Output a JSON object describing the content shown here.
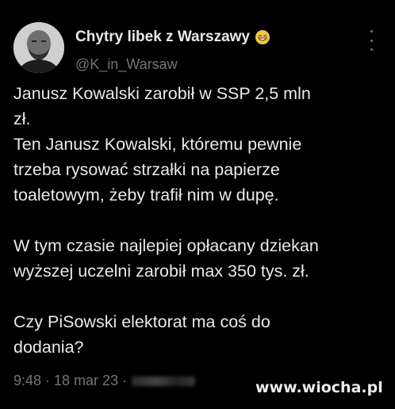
{
  "author": {
    "display_name": "Chytry libek z Warszawy",
    "emoji": "grinning-sweat-emoji",
    "handle": "@K_in_Warsaw"
  },
  "tweet": {
    "paragraphs": [
      {
        "lines": [
          "Janusz Kowalski zarobił w SSP 2,5 mln",
          "zł.",
          "Ten Janusz Kowalski, któremu pewnie",
          "trzeba rysować strzałki na papierze",
          "toaletowym, żeby trafił nim w dupę."
        ]
      },
      {
        "lines": [
          "W tym czasie najlepiej opłacany dziekan",
          "wyższej uczelni zarobił max 350 tys. zł."
        ]
      },
      {
        "lines": [
          "Czy PiSowski elektorat ma coś do",
          "dodania?"
        ]
      }
    ],
    "timestamp": "9:48 · 18 mar 23 ·"
  },
  "watermark": "www.wiocha.pl",
  "colors": {
    "background": "#000000",
    "text": "#e7e9ea",
    "secondary_text": "#71767b"
  }
}
